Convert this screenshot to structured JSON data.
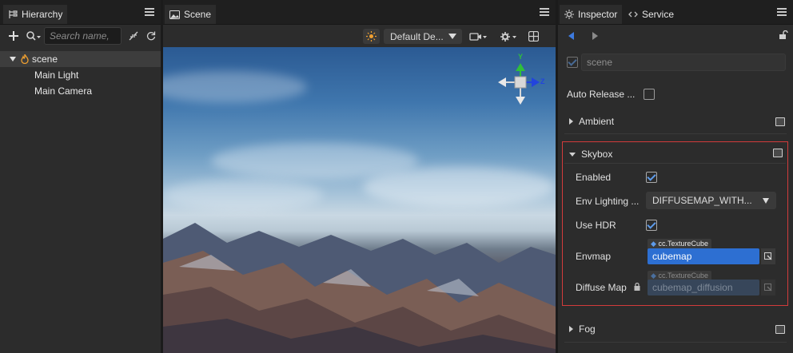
{
  "hierarchy": {
    "tab_label": "Hierarchy",
    "search_placeholder": "Search name,",
    "tree": [
      {
        "label": "scene",
        "expanded": true,
        "icon": "fire-icon"
      },
      {
        "label": "Main Light"
      },
      {
        "label": "Main Camera"
      }
    ]
  },
  "scene": {
    "tab_label": "Scene",
    "camera_dropdown": "Default De...",
    "gizmo": {
      "y": "Y",
      "z": "Z"
    }
  },
  "inspector": {
    "tab_label": "Inspector",
    "service_tab_label": "Service",
    "node_name": "scene",
    "auto_release_label": "Auto Release ...",
    "ambient_label": "Ambient",
    "skybox": {
      "label": "Skybox",
      "enabled_label": "Enabled",
      "env_lighting_label": "Env Lighting ...",
      "env_lighting_value": "DIFFUSEMAP_WITH...",
      "use_hdr_label": "Use HDR",
      "envmap_label": "Envmap",
      "envmap_type": "cc.TextureCube",
      "envmap_value": "cubemap",
      "diffuse_map_label": "Diffuse Map",
      "diffuse_map_type": "cc.TextureCube",
      "diffuse_map_value": "cubemap_diffusion"
    },
    "fog_label": "Fog"
  },
  "colors": {
    "accent_blue": "#2d6fd2",
    "highlight_red": "#d23b3b",
    "panel_bg": "#2c2c2c"
  }
}
